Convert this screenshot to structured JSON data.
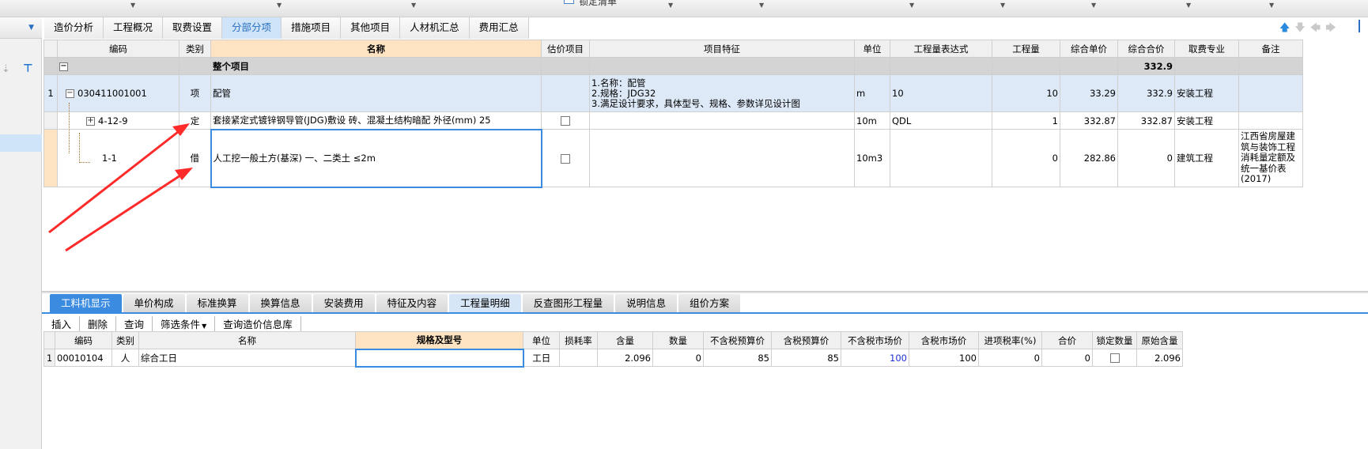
{
  "top_strip": {
    "checkbox_label": "锁定清单"
  },
  "left_panel": {
    "dropdown_arrow": "▼"
  },
  "tabs": [
    "造价分析",
    "工程概况",
    "取费设置",
    "分部分项",
    "措施项目",
    "其他项目",
    "人材机汇总",
    "费用汇总"
  ],
  "active_tab": "分部分项",
  "nav_icons": [
    "arrow-up-icon",
    "arrow-down-icon",
    "arrow-left-icon",
    "arrow-right-icon"
  ],
  "grid": {
    "columns": [
      "编码",
      "类别",
      "名称",
      "估价项目",
      "项目特征",
      "单位",
      "工程量表达式",
      "工程量",
      "综合单价",
      "综合合价",
      "取费专业",
      "备注"
    ],
    "total_row": {
      "name": "整个项目",
      "total_price": "332.9"
    },
    "rows": [
      {
        "rownum": "1",
        "code": "030411001001",
        "type": "项",
        "name": "配管",
        "features": [
          "1.名称：配管",
          "2.规格：JDG32",
          "3.满足设计要求，具体型号、规格、参数详见设计图"
        ],
        "unit": "m",
        "expr": "10",
        "qty": "10",
        "unit_price": "33.29",
        "total_price": "332.9",
        "specialty": "安装工程",
        "note": ""
      },
      {
        "rownum": "",
        "code": "4-12-9",
        "type": "定",
        "name": "套接紧定式镀锌钢导管(JDG)敷设 砖、混凝土结构暗配 外径(mm) 25",
        "features": [],
        "unit": "10m",
        "expr": "QDL",
        "qty": "1",
        "unit_price": "332.87",
        "total_price": "332.87",
        "specialty": "安装工程",
        "note": ""
      },
      {
        "rownum": "",
        "code": "1-1",
        "type": "借",
        "name": "人工挖一般土方(基深) 一、二类土 ≤2m",
        "features": [],
        "unit": "10m3",
        "expr": "",
        "qty": "0",
        "unit_price": "282.86",
        "total_price": "0",
        "specialty": "建筑工程",
        "note": "江西省房屋建筑与装饰工程消耗量定额及统一基价表(2017)"
      }
    ]
  },
  "bottom_tabs": [
    "工料机显示",
    "单价构成",
    "标准换算",
    "换算信息",
    "安装费用",
    "特征及内容",
    "工程量明细",
    "反查图形工程量",
    "说明信息",
    "组价方案"
  ],
  "bottom_active_tab": "工料机显示",
  "bottom_toolbar": [
    "插入",
    "删除",
    "查询",
    "筛选条件",
    "查询造价信息库"
  ],
  "bottom_grid": {
    "columns": [
      "编码",
      "类别",
      "名称",
      "规格及型号",
      "单位",
      "损耗率",
      "含量",
      "数量",
      "不含税预算价",
      "含税预算价",
      "不含税市场价",
      "含税市场价",
      "进项税率(%)",
      "合价",
      "锁定数量",
      "原始含量"
    ],
    "rows": [
      {
        "rownum": "1",
        "code": "00010104",
        "type": "人",
        "name": "综合工日",
        "spec": "",
        "unit": "工日",
        "loss": "",
        "content": "2.096",
        "qty": "0",
        "pre_budget_ex": "85",
        "pre_budget_in": "85",
        "market_ex": "100",
        "market_in": "100",
        "tax_rate": "0",
        "total": "0",
        "orig_content": "2.096"
      }
    ]
  },
  "colors": {
    "accent": "#3b8be0",
    "highlight": "#fde3c2",
    "annotation_arrow": "#ff2a2a"
  }
}
